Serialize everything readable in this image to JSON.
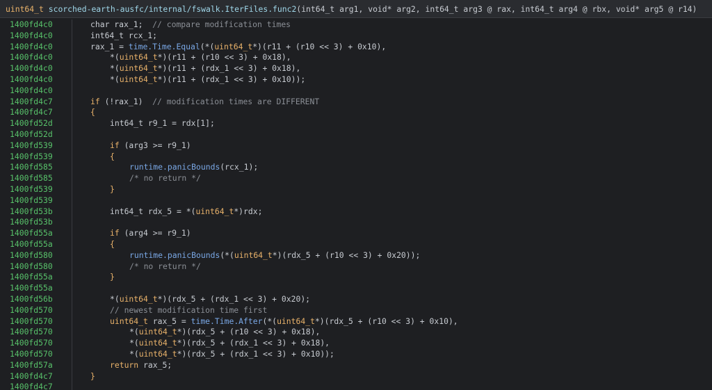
{
  "header": {
    "return_type": "uint64_t",
    "function_name": "scorched-earth-ausfc/internal/fswalk.IterFiles.func2",
    "params": "(int64_t arg1, void* arg2, int64_t arg3 @ rax, int64_t arg4 @ rbx, void* arg5 @ r14)"
  },
  "lines": [
    {
      "addr": "1400fd4c0",
      "indent": 0,
      "tokens": [
        [
          "plain",
          "char rax_1;  "
        ],
        [
          "comment",
          "// compare modification times"
        ]
      ]
    },
    {
      "addr": "1400fd4c0",
      "indent": 0,
      "tokens": [
        [
          "plain",
          "int64_t rcx_1;"
        ]
      ]
    },
    {
      "addr": "1400fd4c0",
      "indent": 0,
      "tokens": [
        [
          "plain",
          "rax_1 = "
        ],
        [
          "func",
          "time.Time.Equal"
        ],
        [
          "plain",
          "(*("
        ],
        [
          "type",
          "uint64_t"
        ],
        [
          "plain",
          "*)(r11 + (r10 << 3) + 0x10),"
        ]
      ]
    },
    {
      "addr": "1400fd4c0",
      "indent": 1,
      "tokens": [
        [
          "plain",
          "*("
        ],
        [
          "type",
          "uint64_t"
        ],
        [
          "plain",
          "*)(r11 + (r10 << 3) + 0x18),"
        ]
      ]
    },
    {
      "addr": "1400fd4c0",
      "indent": 1,
      "tokens": [
        [
          "plain",
          "*("
        ],
        [
          "type",
          "uint64_t"
        ],
        [
          "plain",
          "*)(r11 + (rdx_1 << 3) + 0x18),"
        ]
      ]
    },
    {
      "addr": "1400fd4c0",
      "indent": 1,
      "tokens": [
        [
          "plain",
          "*("
        ],
        [
          "type",
          "uint64_t"
        ],
        [
          "plain",
          "*)(r11 + (rdx_1 << 3) + 0x10));"
        ]
      ]
    },
    {
      "addr": "1400fd4c0",
      "indent": 0,
      "tokens": []
    },
    {
      "addr": "1400fd4c7",
      "indent": 0,
      "tokens": [
        [
          "kw",
          "if"
        ],
        [
          "plain",
          " (!rax_1)  "
        ],
        [
          "comment",
          "// modification times are DIFFERENT"
        ]
      ]
    },
    {
      "addr": "1400fd4c7",
      "indent": 0,
      "tokens": [
        [
          "brace",
          "{"
        ]
      ]
    },
    {
      "addr": "1400fd52d",
      "indent": 1,
      "tokens": [
        [
          "plain",
          "int64_t r9_1 = rdx[1];"
        ]
      ]
    },
    {
      "addr": "1400fd52d",
      "indent": 0,
      "tokens": []
    },
    {
      "addr": "1400fd539",
      "indent": 1,
      "tokens": [
        [
          "kw",
          "if"
        ],
        [
          "plain",
          " (arg3 >= r9_1)"
        ]
      ]
    },
    {
      "addr": "1400fd539",
      "indent": 1,
      "tokens": [
        [
          "brace",
          "{"
        ]
      ]
    },
    {
      "addr": "1400fd585",
      "indent": 2,
      "tokens": [
        [
          "func",
          "runtime.panicBounds"
        ],
        [
          "plain",
          "(rcx_1);"
        ]
      ]
    },
    {
      "addr": "1400fd585",
      "indent": 2,
      "tokens": [
        [
          "comment",
          "/* no return */"
        ]
      ]
    },
    {
      "addr": "1400fd539",
      "indent": 1,
      "tokens": [
        [
          "brace",
          "}"
        ]
      ]
    },
    {
      "addr": "1400fd539",
      "indent": 0,
      "tokens": []
    },
    {
      "addr": "1400fd53b",
      "indent": 1,
      "tokens": [
        [
          "plain",
          "int64_t rdx_5 = *("
        ],
        [
          "type",
          "uint64_t"
        ],
        [
          "plain",
          "*)rdx;"
        ]
      ]
    },
    {
      "addr": "1400fd53b",
      "indent": 0,
      "tokens": []
    },
    {
      "addr": "1400fd55a",
      "indent": 1,
      "tokens": [
        [
          "kw",
          "if"
        ],
        [
          "plain",
          " (arg4 >= r9_1)"
        ]
      ]
    },
    {
      "addr": "1400fd55a",
      "indent": 1,
      "tokens": [
        [
          "brace",
          "{"
        ]
      ]
    },
    {
      "addr": "1400fd580",
      "indent": 2,
      "tokens": [
        [
          "func",
          "runtime.panicBounds"
        ],
        [
          "plain",
          "(*("
        ],
        [
          "type",
          "uint64_t"
        ],
        [
          "plain",
          "*)(rdx_5 + (r10 << 3) + 0x20));"
        ]
      ]
    },
    {
      "addr": "1400fd580",
      "indent": 2,
      "tokens": [
        [
          "comment",
          "/* no return */"
        ]
      ]
    },
    {
      "addr": "1400fd55a",
      "indent": 1,
      "tokens": [
        [
          "brace",
          "}"
        ]
      ]
    },
    {
      "addr": "1400fd55a",
      "indent": 0,
      "tokens": []
    },
    {
      "addr": "1400fd56b",
      "indent": 1,
      "tokens": [
        [
          "plain",
          "*("
        ],
        [
          "type",
          "uint64_t"
        ],
        [
          "plain",
          "*)(rdx_5 + (rdx_1 << 3) + 0x20);"
        ]
      ]
    },
    {
      "addr": "1400fd570",
      "indent": 1,
      "tokens": [
        [
          "comment",
          "// newest modification time first"
        ]
      ]
    },
    {
      "addr": "1400fd570",
      "indent": 1,
      "tokens": [
        [
          "type",
          "uint64_t"
        ],
        [
          "plain",
          " rax_5 = "
        ],
        [
          "func",
          "time.Time.After"
        ],
        [
          "plain",
          "(*("
        ],
        [
          "type",
          "uint64_t"
        ],
        [
          "plain",
          "*)(rdx_5 + (r10 << 3) + 0x10),"
        ]
      ]
    },
    {
      "addr": "1400fd570",
      "indent": 2,
      "tokens": [
        [
          "plain",
          "*("
        ],
        [
          "type",
          "uint64_t"
        ],
        [
          "plain",
          "*)(rdx_5 + (r10 << 3) + 0x18),"
        ]
      ]
    },
    {
      "addr": "1400fd570",
      "indent": 2,
      "tokens": [
        [
          "plain",
          "*("
        ],
        [
          "type",
          "uint64_t"
        ],
        [
          "plain",
          "*)(rdx_5 + (rdx_1 << 3) + 0x18),"
        ]
      ]
    },
    {
      "addr": "1400fd570",
      "indent": 2,
      "tokens": [
        [
          "plain",
          "*("
        ],
        [
          "type",
          "uint64_t"
        ],
        [
          "plain",
          "*)(rdx_5 + (rdx_1 << 3) + 0x10));"
        ]
      ]
    },
    {
      "addr": "1400fd57a",
      "indent": 1,
      "tokens": [
        [
          "kw",
          "return"
        ],
        [
          "plain",
          " rax_5;"
        ]
      ]
    },
    {
      "addr": "1400fd4c7",
      "indent": 0,
      "tokens": [
        [
          "brace",
          "}"
        ]
      ]
    },
    {
      "addr": "1400fd4c7",
      "indent": 0,
      "tokens": []
    }
  ],
  "colors": {
    "background": "#1e1f22",
    "address": "#58c26a",
    "type": "#e9b26a",
    "function": "#7aa8e6",
    "comment": "#8b8f96"
  }
}
